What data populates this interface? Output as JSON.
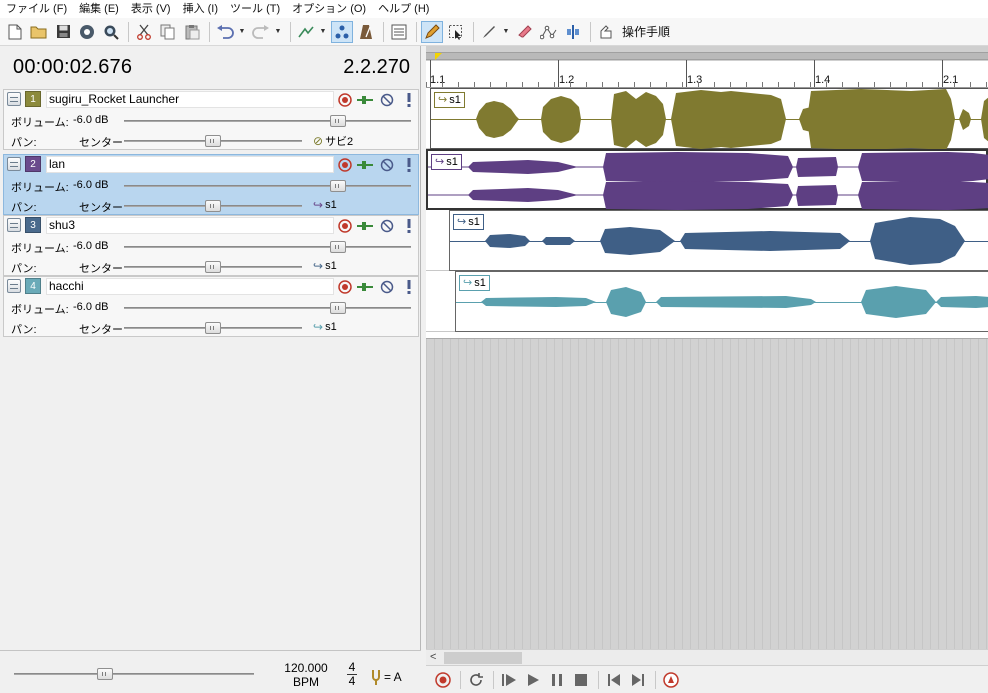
{
  "menu": [
    "ファイル (F)",
    "編集 (E)",
    "表示 (V)",
    "挿入 (I)",
    "ツール (T)",
    "オプション (O)",
    "ヘルプ (H)"
  ],
  "toolbar": {
    "guide_label": "操作手順"
  },
  "transport_display": {
    "time": "00:00:02.676",
    "beat": "2.2.270"
  },
  "tracks": [
    {
      "number": "1",
      "name": "sugiru_Rocket Launcher",
      "color": "#8c8a3c",
      "volume_label": "ボリューム:",
      "volume_value": "-6.0 dB",
      "pan_label": "パン:",
      "pan_value": "センター",
      "send": "サビ2",
      "volume_level": 0.75,
      "pan_level": 0.5
    },
    {
      "number": "2",
      "name": "lan",
      "color": "#6a4a8c",
      "volume_label": "ボリューム:",
      "volume_value": "-6.0 dB",
      "pan_label": "パン:",
      "pan_value": "センター",
      "send": "s1",
      "volume_level": 0.75,
      "pan_level": 0.5
    },
    {
      "number": "3",
      "name": "shu3",
      "color": "#4a6a8c",
      "volume_label": "ボリューム:",
      "volume_value": "-6.0 dB",
      "pan_label": "パン:",
      "pan_value": "センター",
      "send": "s1",
      "volume_level": 0.75,
      "pan_level": 0.5
    },
    {
      "number": "4",
      "name": "hacchi",
      "color": "#6aaab8",
      "volume_label": "ボリューム:",
      "volume_value": "-6.0 dB",
      "pan_label": "パン:",
      "pan_value": "センター",
      "send": "s1",
      "volume_level": 0.75,
      "pan_level": 0.5
    }
  ],
  "master": {
    "tempo": "120.000",
    "tempo_unit": "BPM",
    "meter_top": "4",
    "meter_bottom": "4",
    "tuning": "= A"
  },
  "ruler": [
    "1.1",
    "1.2",
    "1.3",
    "1.4",
    "2.1"
  ],
  "clips": [
    {
      "label": "s1",
      "color": "#807a30"
    },
    {
      "label": "s1",
      "color": "#5e3f83"
    },
    {
      "label": "s1",
      "color": "#3f5f86"
    },
    {
      "label": "s1",
      "color": "#5aa0ae"
    }
  ],
  "colors": {
    "selected_track": "#b9d6ef",
    "record": "#c0392b",
    "accent": "#2b7cd3"
  }
}
